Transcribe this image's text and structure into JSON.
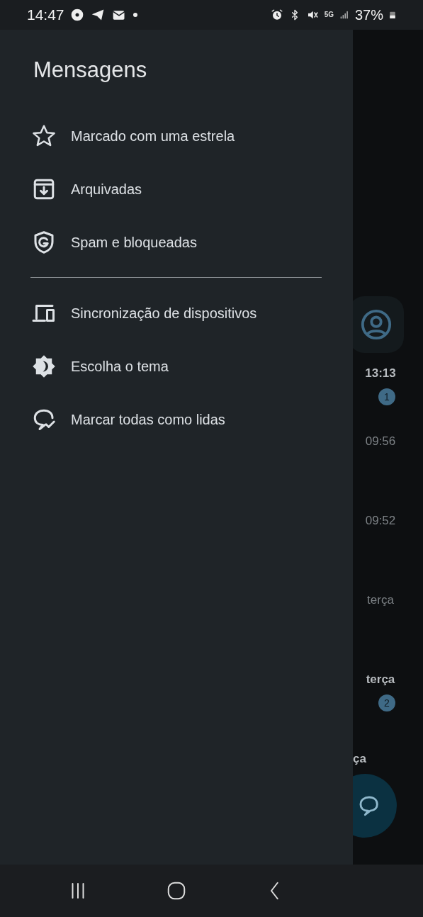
{
  "status_bar": {
    "time": "14:47",
    "network": "5G",
    "battery": "37%"
  },
  "drawer": {
    "title": "Mensagens",
    "sections": [
      [
        {
          "kind": "star",
          "label": "Marcado com uma estrela"
        },
        {
          "kind": "archive",
          "label": "Arquivadas"
        },
        {
          "kind": "shield",
          "label": "Spam e bloqueadas"
        }
      ],
      [
        {
          "kind": "devices",
          "label": "Sincronização de dispositivos"
        },
        {
          "kind": "theme",
          "label": "Escolha o tema"
        },
        {
          "kind": "markread",
          "label": "Marcar todas como lidas"
        }
      ]
    ]
  },
  "conversations": [
    {
      "time": "13:13",
      "unread": true,
      "badge": "1"
    },
    {
      "time": "09:56",
      "unread": false
    },
    {
      "time": "09:52",
      "unread": false
    },
    {
      "time": "terça",
      "unread": false
    },
    {
      "time": "terça",
      "unread": true,
      "badge": "2"
    },
    {
      "time": "ça",
      "unread": true
    }
  ]
}
